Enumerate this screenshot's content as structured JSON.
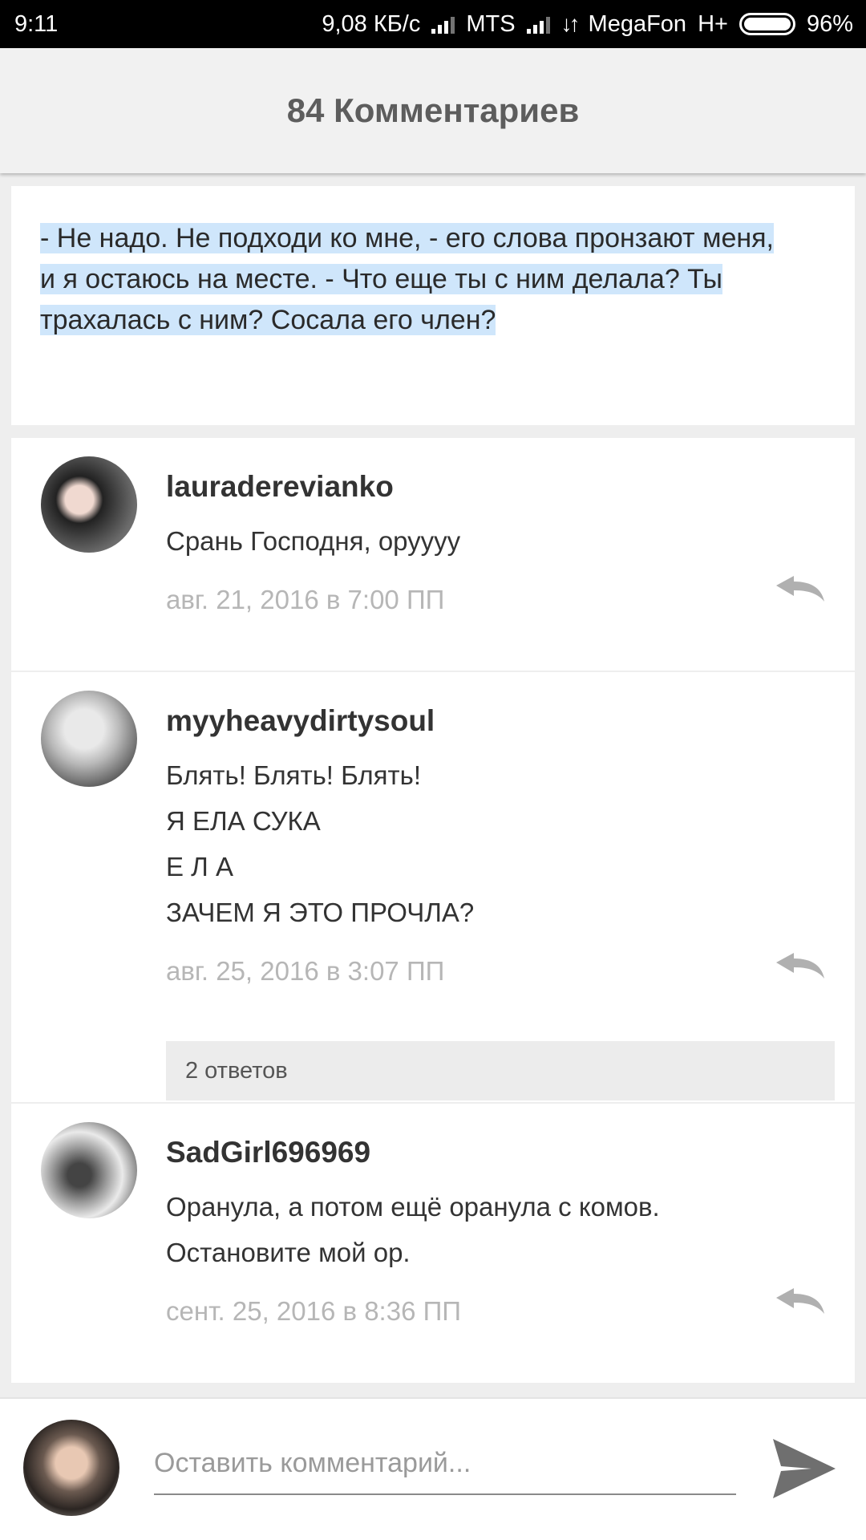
{
  "status_bar": {
    "time": "9:11",
    "network_speed": "9,08 КБ/с",
    "carrier1": "MTS",
    "carrier2": "MegaFon",
    "network_type": "H+",
    "battery": "96%",
    "icons": [
      "signal-icon",
      "data-arrows-icon",
      "battery-icon"
    ]
  },
  "header": {
    "title": "84 Комментариев"
  },
  "quote": {
    "lines": [
      "- Не надо. Не подходи ко мне, - его слова пронзают меня,",
      "и я остаюсь на месте. - Что еще ты с ним делала? Ты",
      "трахалась с ним? Сосала его член? "
    ]
  },
  "comments": [
    {
      "username": "lauraderevianko",
      "lines": [
        "Срань Господня, оруууу"
      ],
      "date": "авг. 21, 2016 в 7:00 ПП"
    },
    {
      "username": "myyheavydirtysoul",
      "lines": [
        "Блять! Блять! Блять!",
        "Я ЕЛА СУКА",
        "Е Л А",
        "ЗАЧЕМ Я ЭТО ПРОЧЛА?"
      ],
      "date": "авг. 25, 2016 в 3:07 ПП",
      "replies_label": "2 ответов"
    },
    {
      "username": "SadGirl696969",
      "lines": [
        "Оранула, а потом ещё оранула с комов.",
        "Остановите мой ор."
      ],
      "date": "сент. 25, 2016 в 8:36 ПП"
    }
  ],
  "composer": {
    "placeholder": "Оставить комментарий..."
  },
  "colors": {
    "highlight": "#cfe6fb",
    "header_bg": "#f1f1f1",
    "date_text": "#b6b6b6",
    "icon_gray": "#6f6f6f"
  }
}
